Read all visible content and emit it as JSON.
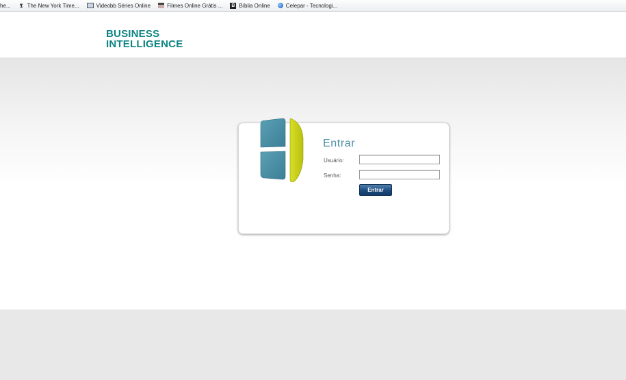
{
  "bookmarks": [
    {
      "label": "che...",
      "icon": "none"
    },
    {
      "label": "The New York Time...",
      "icon": "nyt-icon"
    },
    {
      "label": "Videobb Séries Online",
      "icon": "film-icon"
    },
    {
      "label": "Filmes Online Grátis ...",
      "icon": "clapper-icon"
    },
    {
      "label": "Bíblia Online",
      "icon": "bible-icon"
    },
    {
      "label": "Celepar - Tecnologi...",
      "icon": "globe-icon"
    }
  ],
  "brand": {
    "line1": "BUSINESS",
    "line2": "INTELLIGENCE",
    "color": "#0e8482"
  },
  "login": {
    "title": "Entrar",
    "username_label": "Usuário:",
    "password_label": "Senha:",
    "username_value": "",
    "password_value": "",
    "submit_label": "Entrar"
  },
  "colors": {
    "logo_blue": "#4b8fa6",
    "logo_yellow": "#c8cf16",
    "title": "#4e8fa4",
    "button": "#1d4b7e"
  }
}
